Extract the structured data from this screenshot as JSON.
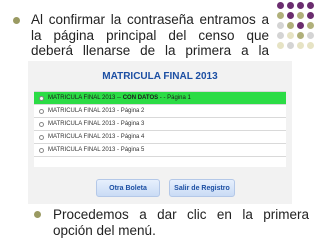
{
  "slide": {
    "paragraph1": "Al confirmar la contraseña entramos a la página principal del censo que deberá llenarse de la primera a la última:",
    "paragraph2": "Procedemos a dar clic en la primera opción del menú."
  },
  "screenshot": {
    "title": "MATRICULA FINAL 2013",
    "rows": [
      {
        "prefix": "MATRICULA FINAL 2013 -- ",
        "highlight": "CON DATOS",
        "suffix": " - - Página 1"
      },
      {
        "prefix": "MATRICULA FINAL 2013 - Página 2",
        "highlight": "",
        "suffix": ""
      },
      {
        "prefix": "MATRICULA FINAL 2013 - Página 3",
        "highlight": "",
        "suffix": ""
      },
      {
        "prefix": "MATRICULA FINAL 2013 - Página 4",
        "highlight": "",
        "suffix": ""
      },
      {
        "prefix": "MATRICULA FINAL 2013 - Página 5",
        "highlight": "",
        "suffix": ""
      }
    ],
    "buttons": {
      "otra_boleta": "Otra Boleta",
      "salir": "Salir de Registro"
    }
  },
  "colors": {
    "accent_green": "#2bdc45",
    "title_blue": "#1c4fa3",
    "dot_purple": "#6b2d6f",
    "dot_olive": "#b0b07a",
    "dot_light": "#d4d4d4",
    "dot_pale": "#e6e3c4"
  },
  "decor": {
    "dot_grid": [
      "dot_purple",
      "dot_purple",
      "dot_purple",
      "dot_purple",
      "dot_olive",
      "dot_purple",
      "dot_olive",
      "dot_purple",
      "dot_light",
      "dot_olive",
      "dot_purple",
      "dot_olive",
      "dot_light",
      "dot_pale",
      "dot_olive",
      "dot_light",
      "dot_pale",
      "dot_light",
      "dot_pale",
      "dot_pale"
    ]
  }
}
